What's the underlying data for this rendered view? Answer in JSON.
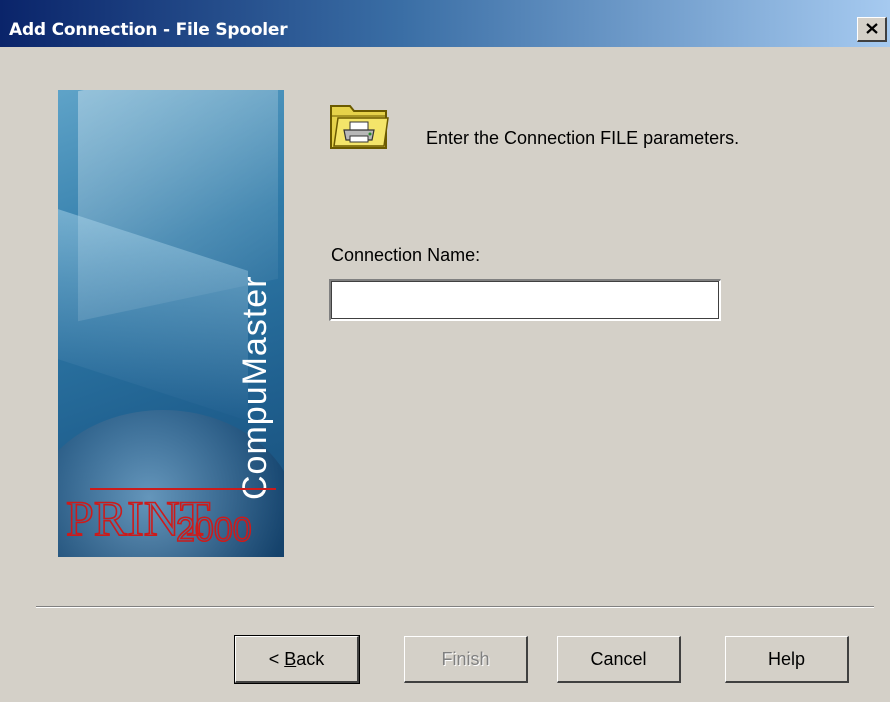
{
  "window": {
    "title": "Add Connection - File Spooler",
    "close_label": "✕"
  },
  "banner": {
    "brand": "CompuMaster",
    "logo_text": "PRINT",
    "logo_number": "2000"
  },
  "content": {
    "icon": "folder-printer-icon",
    "instruction": "Enter the Connection FILE parameters.",
    "connection_name_label": "Connection Name:",
    "connection_name_value": "",
    "connection_name_placeholder": ""
  },
  "buttons": {
    "back_prefix": "< ",
    "back_mnemonic": "B",
    "back_rest": "ack",
    "finish": "Finish",
    "cancel": "Cancel",
    "help": "Help"
  },
  "colors": {
    "title_start": "#0a246a",
    "title_end": "#a6caf0",
    "dialog_bg": "#d4d0c8",
    "logo_red": "#cc1b1b"
  }
}
